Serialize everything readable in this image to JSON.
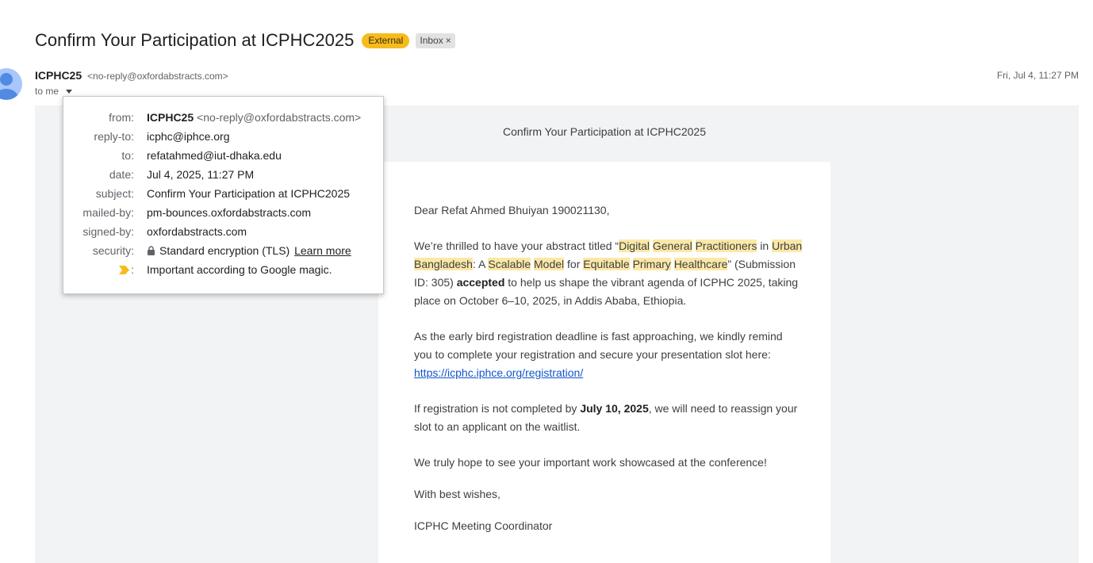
{
  "subject": "Confirm Your Participation at ICPHC2025",
  "labels": {
    "external": "External",
    "inbox": "Inbox",
    "remove": "×"
  },
  "sender": {
    "name": "ICPHC25",
    "email": "<no-reply@oxfordabstracts.com>"
  },
  "recipient_short": "to me",
  "date": "Fri, Jul 4, 11:27 PM",
  "details": {
    "from_label": "from:",
    "from_name": "ICPHC25",
    "from_email": "<no-reply@oxfordabstracts.com>",
    "replyto_label": "reply-to:",
    "replyto": "icphc@iphce.org",
    "to_label": "to:",
    "to": "refatahmed@iut-dhaka.edu",
    "date_label": "date:",
    "date": "Jul 4, 2025, 11:27 PM",
    "subject_label": "subject:",
    "subject": "Confirm Your Participation at ICPHC2025",
    "mailedby_label": "mailed-by:",
    "mailedby": "pm-bounces.oxfordabstracts.com",
    "signedby_label": "signed-by:",
    "signedby": "oxfordabstracts.com",
    "security_label": "security:",
    "security": "Standard encryption (TLS)",
    "learn_more": "Learn more",
    "importance_label": ":",
    "importance": "Important according to Google magic."
  },
  "email": {
    "header_title": "Confirm Your Participation at ICPHC2025",
    "greeting": "Dear Refat Ahmed Bhuiyan 190021130,",
    "p1": {
      "before": "We’re thrilled to have your abstract titled “",
      "title_words": [
        "Digital",
        "General",
        "Practitioners",
        "in",
        "Urban",
        "Bangladesh",
        ": A ",
        "Scalable",
        "Model",
        "for",
        "Equitable",
        "Primary",
        "Healthcare"
      ],
      "after_title": "”",
      "mid": " (Submission ID: 305) ",
      "accepted": "accepted",
      "end": " to help us shape the vibrant agenda of ICPHC 2025, taking place on October 6–10, 2025, in Addis Ababa, Ethiopia."
    },
    "p2": "As the early bird registration deadline is fast approaching, we kindly remind you to complete your registration and secure your presentation slot here:",
    "link": "https://icphc.iphce.org/registration/",
    "p3_before": "If registration is not completed by ",
    "p3_date": "July 10, 2025",
    "p3_after": ", we will need to reassign your slot to an applicant on the waitlist.",
    "p4": "We truly hope to see your important work showcased at the conference!",
    "closing": "With best wishes,",
    "signature": "ICPHC Meeting Coordinator"
  }
}
